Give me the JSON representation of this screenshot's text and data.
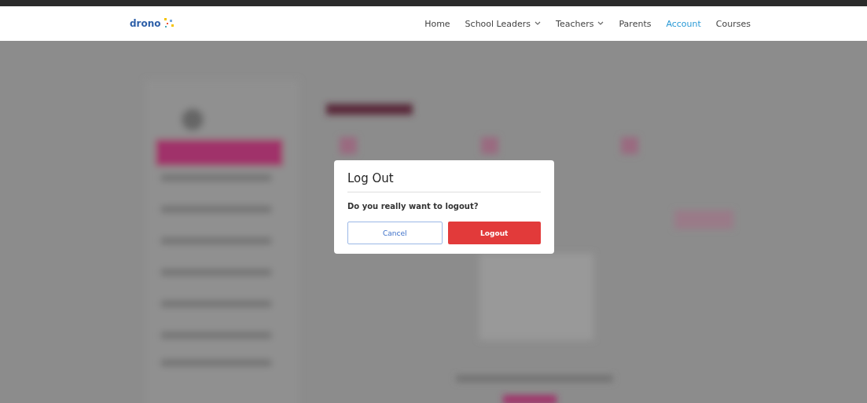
{
  "header": {
    "logo": "drono",
    "nav": [
      {
        "label": "Home",
        "dropdown": false,
        "selected": false
      },
      {
        "label": "School Leaders",
        "dropdown": true,
        "selected": false
      },
      {
        "label": "Teachers",
        "dropdown": true,
        "selected": false
      },
      {
        "label": "Parents",
        "dropdown": false,
        "selected": false
      },
      {
        "label": "Account",
        "dropdown": false,
        "selected": true
      },
      {
        "label": "Courses",
        "dropdown": false,
        "selected": false
      }
    ]
  },
  "dialog": {
    "title": "Log Out",
    "message": "Do you really want to logout?",
    "cancel": "Cancel",
    "confirm": "Logout"
  }
}
